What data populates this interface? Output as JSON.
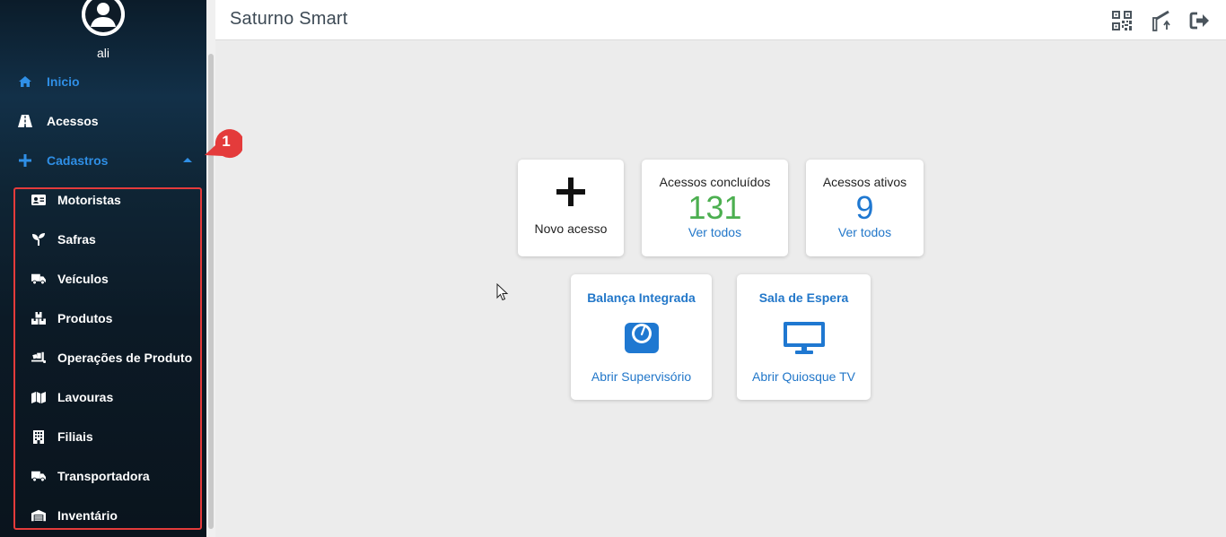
{
  "app": {
    "title": "Saturno Smart"
  },
  "user": {
    "name": "ali"
  },
  "sidebar": {
    "items": [
      {
        "label": "Inicio",
        "icon": "home-icon"
      },
      {
        "label": "Acessos",
        "icon": "road-icon"
      },
      {
        "label": "Cadastros",
        "icon": "plus-icon"
      }
    ],
    "submenu": [
      {
        "label": "Motoristas",
        "icon": "id-card-icon"
      },
      {
        "label": "Safras",
        "icon": "seedling-icon"
      },
      {
        "label": "Veículos",
        "icon": "truck-icon"
      },
      {
        "label": "Produtos",
        "icon": "boxes-icon"
      },
      {
        "label": "Operações de Produto",
        "icon": "truck-loading-icon"
      },
      {
        "label": "Lavouras",
        "icon": "map-icon"
      },
      {
        "label": "Filiais",
        "icon": "building-icon"
      },
      {
        "label": "Transportadora",
        "icon": "truck-icon"
      },
      {
        "label": "Inventário",
        "icon": "warehouse-icon"
      }
    ],
    "callout_number": "1"
  },
  "header": {
    "icons": [
      "qrcode-icon",
      "barrier-gate-icon",
      "logout-icon"
    ]
  },
  "cards": {
    "novo_acesso": {
      "label": "Novo acesso"
    },
    "concluidos": {
      "label": "Acessos concluídos",
      "value": "131",
      "link": "Ver todos"
    },
    "ativos": {
      "label": "Acessos ativos",
      "value": "9",
      "link": "Ver todos"
    },
    "balanca": {
      "title": "Balança Integrada",
      "link": "Abrir Supervisório"
    },
    "espera": {
      "title": "Sala de Espera",
      "link": "Abrir Quiosque TV"
    }
  },
  "colors": {
    "accent_blue": "#2f8fe6",
    "link_blue": "#2277c9",
    "green": "#4caf50",
    "count_blue": "#1f78d1",
    "highlight_red": "#e43b3b"
  }
}
